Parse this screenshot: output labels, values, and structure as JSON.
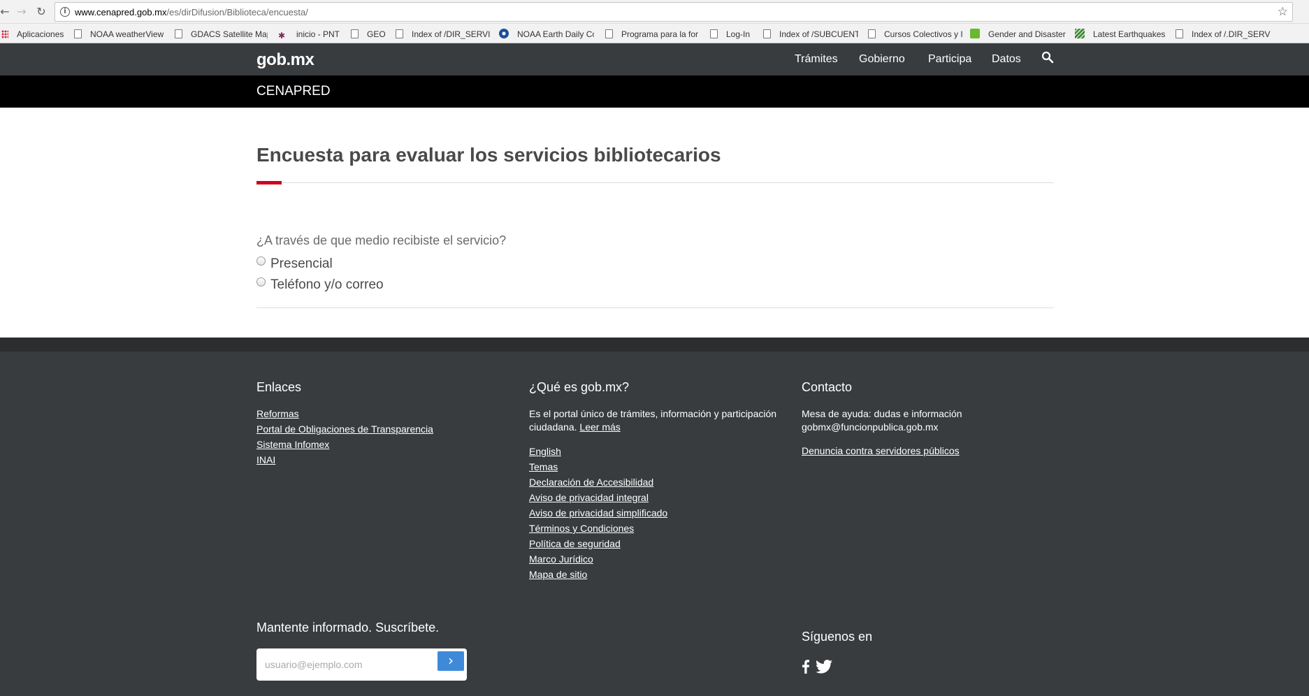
{
  "browser": {
    "url_host": "www.cenapred.gob.mx",
    "url_path": "/es/dirDifusion/Biblioteca/encuesta/",
    "bookmarks": [
      {
        "label": "Aplicaciones",
        "icon": "apps-icon"
      },
      {
        "label": "NOAA weatherView",
        "icon": "page-icon"
      },
      {
        "label": "GDACS Satellite Map",
        "icon": "page-icon"
      },
      {
        "label": "inicio - PNT",
        "icon": "pnt-icon"
      },
      {
        "label": "GEO",
        "icon": "page-icon"
      },
      {
        "label": "Index of /DIR_SERVI",
        "icon": "page-icon"
      },
      {
        "label": "NOAA Earth Daily Co",
        "icon": "noaa-icon"
      },
      {
        "label": "Programa para la for",
        "icon": "page-icon"
      },
      {
        "label": "Log-In",
        "icon": "page-icon"
      },
      {
        "label": "Index of /SUBCUENT",
        "icon": "page-icon"
      },
      {
        "label": "Cursos Colectivos y I",
        "icon": "page-icon"
      },
      {
        "label": "Gender and Disaster",
        "icon": "gender-icon"
      },
      {
        "label": "Latest Earthquakes",
        "icon": "earthquake-icon"
      },
      {
        "label": "Index of /.DIR_SERVI",
        "icon": "page-icon"
      }
    ]
  },
  "header": {
    "logo": "gob.mx",
    "nav": [
      "Trámites",
      "Gobierno",
      "Participa",
      "Datos"
    ],
    "section": "CENAPRED"
  },
  "main": {
    "title": "Encuesta para evaluar los servicios bibliotecarios",
    "question": "¿A través de que medio recibiste el servicio?",
    "options": [
      "Presencial",
      "Teléfono y/o correo"
    ]
  },
  "footer": {
    "enlaces": {
      "heading": "Enlaces",
      "links": [
        "Reformas",
        "Portal de Obligaciones de Transparencia",
        "Sistema Infomex",
        "INAI"
      ]
    },
    "que_es": {
      "heading": "¿Qué es gob.mx?",
      "description": "Es el portal único de trámites, información y participación ciudadana.",
      "read_more": "Leer más",
      "links": [
        "English",
        "Temas",
        "Declaración de Accesibilidad",
        "Aviso de privacidad integral",
        "Aviso de privacidad simplificado",
        "Términos y Condiciones",
        "Política de seguridad",
        "Marco Jurídico",
        "Mapa de sitio"
      ]
    },
    "contacto": {
      "heading": "Contacto",
      "help_text": "Mesa de ayuda: dudas e información",
      "email": "gobmx@funcionpublica.gob.mx",
      "denuncia": "Denuncia contra servidores públicos"
    },
    "subscribe": {
      "heading": "Mantente informado. Suscríbete.",
      "placeholder": "usuario@ejemplo.com"
    },
    "social": {
      "heading": "Síguenos en"
    }
  },
  "colors": {
    "header_bg": "#393c3e",
    "accent_red": "#d0021b",
    "button_blue": "#3f8ad8"
  }
}
